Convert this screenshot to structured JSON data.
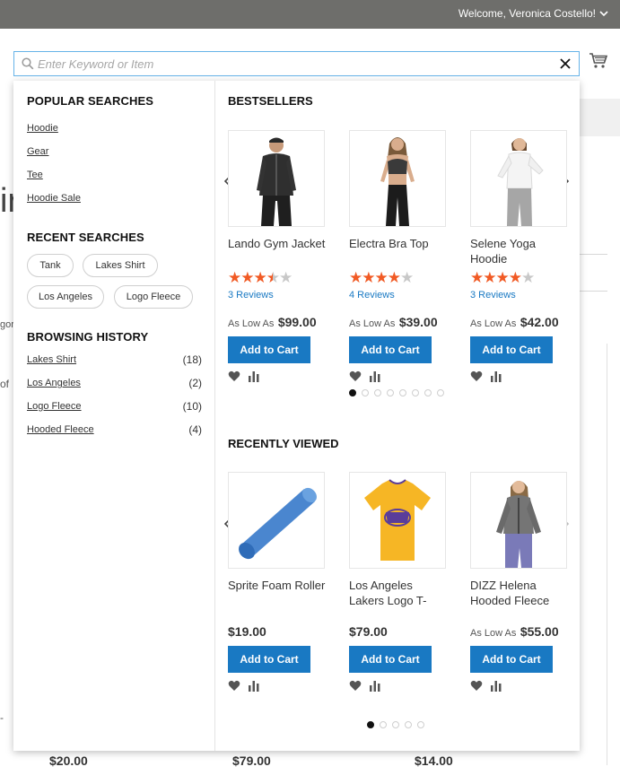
{
  "header": {
    "welcome": "Welcome, Veronica Costello!"
  },
  "search": {
    "placeholder": "Enter Keyword or Item",
    "value": ""
  },
  "background": {
    "big_letter": "ir",
    "frag_a": "gor",
    "frag_b": "of",
    "frag_c": "-",
    "prices": [
      "$20.00",
      "$79.00",
      "$14.00"
    ]
  },
  "popular": {
    "title": "POPULAR SEARCHES",
    "items": [
      "Hoodie",
      "Gear",
      "Tee",
      "Hoodie Sale"
    ]
  },
  "recent": {
    "title": "RECENT SEARCHES",
    "items": [
      "Tank",
      "Lakes Shirt",
      "Los Angeles",
      "Logo Fleece"
    ]
  },
  "history": {
    "title": "BROWSING HISTORY",
    "items": [
      {
        "label": "Lakes Shirt",
        "count": "(18)"
      },
      {
        "label": "Los Angeles",
        "count": "(2)"
      },
      {
        "label": "Logo Fleece",
        "count": "(10)"
      },
      {
        "label": "Hooded Fleece",
        "count": "(4)"
      }
    ]
  },
  "bestsellers": {
    "title": "BESTSELLERS",
    "products": [
      {
        "name": "Lando Gym Jacket",
        "rating": 3.5,
        "reviews": "3 Reviews",
        "as_low_as": "As Low As",
        "price": "$99.00",
        "image": "man-jacket"
      },
      {
        "name": "Electra Bra Top",
        "rating": 4,
        "reviews": "4 Reviews",
        "as_low_as": "As Low As",
        "price": "$39.00",
        "image": "woman-bra-top"
      },
      {
        "name": "Selene Yoga Hoodie",
        "rating": 4,
        "reviews": "3 Reviews",
        "as_low_as": "As Low As",
        "price": "$42.00",
        "image": "woman-hoodie"
      }
    ],
    "pages": 8,
    "active_page": 1
  },
  "recently_viewed": {
    "title": "RECENTLY VIEWED",
    "products": [
      {
        "name": "Sprite Foam Roller",
        "price": "$19.00",
        "image": "foam-roller"
      },
      {
        "name": "Los Angeles Lakers Logo T-",
        "price": "$79.00",
        "image": "lakers-tshirt"
      },
      {
        "name": "DIZZ Helena Hooded Fleece",
        "as_low_as": "As Low As",
        "price": "$55.00",
        "image": "woman-fleece"
      }
    ],
    "pages": 5,
    "active_page": 1
  },
  "buttons": {
    "add_to_cart": "Add to Cart"
  },
  "colors": {
    "accent": "#1979c3",
    "star": "#f15a24",
    "topbar": "#6e6e6b"
  }
}
